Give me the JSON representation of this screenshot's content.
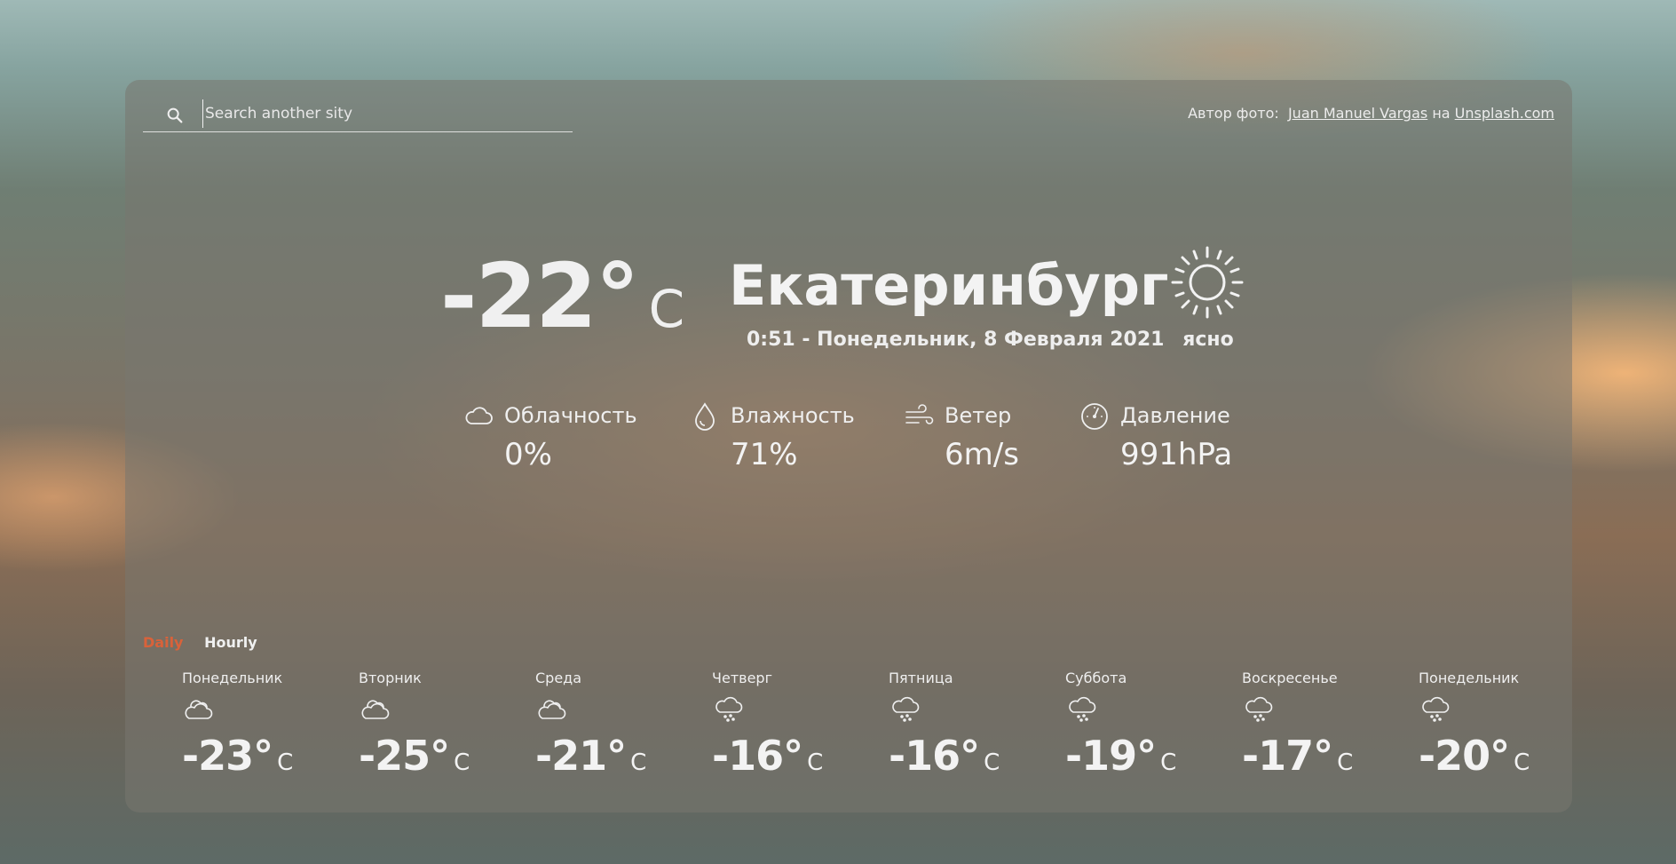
{
  "search": {
    "placeholder": "Search another sity",
    "value": ""
  },
  "credit": {
    "prefix": "Автор фото:",
    "author": "Juan Manuel Vargas",
    "joiner": "на",
    "site": "Unsplash.com"
  },
  "current": {
    "temperature": "-22°",
    "unit": "C",
    "city": "Екатеринбург",
    "datetime": "0:51 - Понедельник, 8 Февраля 2021",
    "condition": "ясно",
    "condition_icon": "sun-icon"
  },
  "stats": [
    {
      "label": "Облачность",
      "value": "0%",
      "icon": "cloud-icon"
    },
    {
      "label": "Влажность",
      "value": "71%",
      "icon": "humidity-drop-icon"
    },
    {
      "label": "Ветер",
      "value": "6m/s",
      "icon": "wind-icon"
    },
    {
      "label": "Давление",
      "value": "991hPa",
      "icon": "pressure-gauge-icon"
    }
  ],
  "tabs": {
    "daily": "Daily",
    "hourly": "Hourly",
    "active": "Daily"
  },
  "forecast": [
    {
      "day": "Понедельник",
      "temp": "-23°",
      "unit": "C",
      "icon": "clouds-icon"
    },
    {
      "day": "Вторник",
      "temp": "-25°",
      "unit": "C",
      "icon": "clouds-icon"
    },
    {
      "day": "Среда",
      "temp": "-21°",
      "unit": "C",
      "icon": "clouds-icon"
    },
    {
      "day": "Четверг",
      "temp": "-16°",
      "unit": "C",
      "icon": "snow-cloud-icon"
    },
    {
      "day": "Пятница",
      "temp": "-16°",
      "unit": "C",
      "icon": "snow-cloud-icon"
    },
    {
      "day": "Суббота",
      "temp": "-19°",
      "unit": "C",
      "icon": "snow-cloud-icon"
    },
    {
      "day": "Воскресенье",
      "temp": "-17°",
      "unit": "C",
      "icon": "snow-cloud-icon"
    },
    {
      "day": "Понедельник",
      "temp": "-20°",
      "unit": "C",
      "icon": "snow-cloud-icon"
    }
  ],
  "colors": {
    "active_tab": "#d9623a",
    "text": "#f0f0f0"
  }
}
